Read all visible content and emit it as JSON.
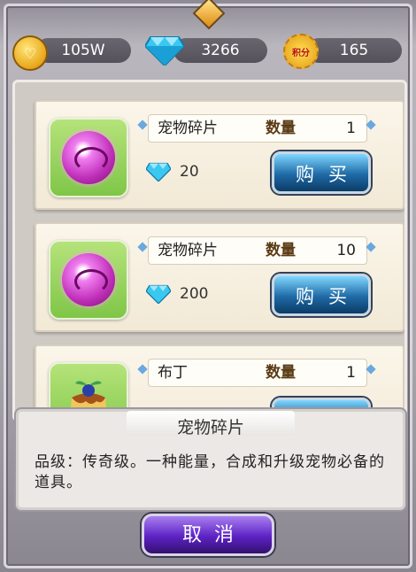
{
  "currency": {
    "gold": "105W",
    "gold_icon_text": "♡",
    "diamonds": "3266",
    "points": "165",
    "points_badge": "积分"
  },
  "items": [
    {
      "name": "宠物碎片",
      "qty_label": "数量",
      "qty": "1",
      "price": "20",
      "buy_label": "购买",
      "icon": "pink-orb-icon"
    },
    {
      "name": "宠物碎片",
      "qty_label": "数量",
      "qty": "10",
      "price": "200",
      "buy_label": "购买",
      "icon": "pink-orb-icon"
    },
    {
      "name": "布丁",
      "qty_label": "数量",
      "qty": "1",
      "icon": "pudding-icon"
    }
  ],
  "tooltip": {
    "title": "宠物碎片",
    "description": "品级：传奇级。一种能量，合成和升级宠物必备的道具。"
  },
  "cancel_label": "取消",
  "colors": {
    "buy": "#1f6aa6",
    "cancel": "#5c22c4",
    "card": "#f7f0e0",
    "icon_bg": "#9bd45f"
  }
}
